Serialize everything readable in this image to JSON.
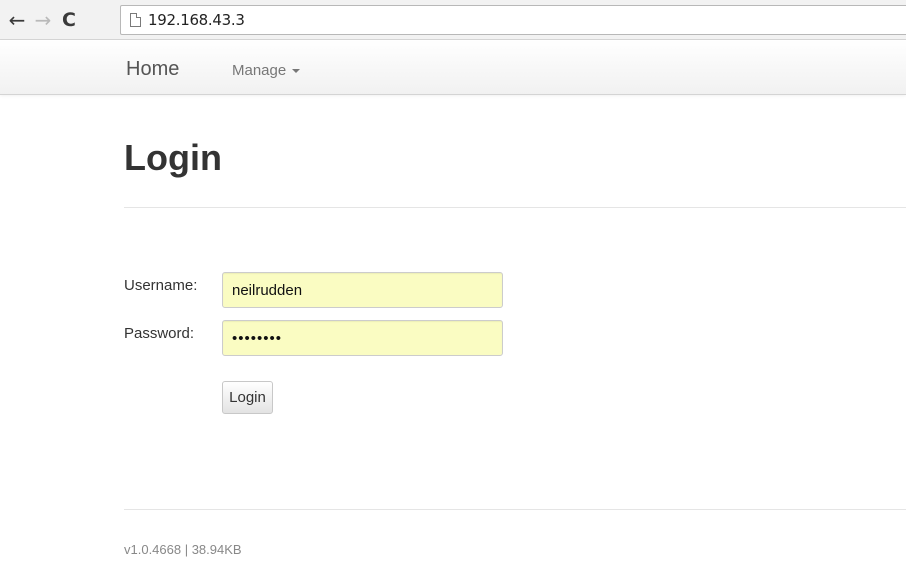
{
  "browser": {
    "back_glyph": "←",
    "forward_glyph": "→",
    "reload_glyph": "C",
    "address": "192.168.43.3",
    "icons": {
      "back": "arrow-left-icon",
      "forward": "arrow-right-icon",
      "reload": "reload-icon",
      "page": "page-icon"
    }
  },
  "navbar": {
    "home_label": "Home",
    "manage_label": "Manage",
    "manage_icon": "caret-down-icon"
  },
  "page": {
    "title": "Login"
  },
  "form": {
    "username_label": "Username:",
    "username_value": "neilrudden",
    "password_label": "Password:",
    "password_value": "••••••••",
    "submit_label": "Login",
    "field_fill_color": "#fafcc2"
  },
  "footer": {
    "version_text": "v1.0.4668 | 38.94KB"
  }
}
